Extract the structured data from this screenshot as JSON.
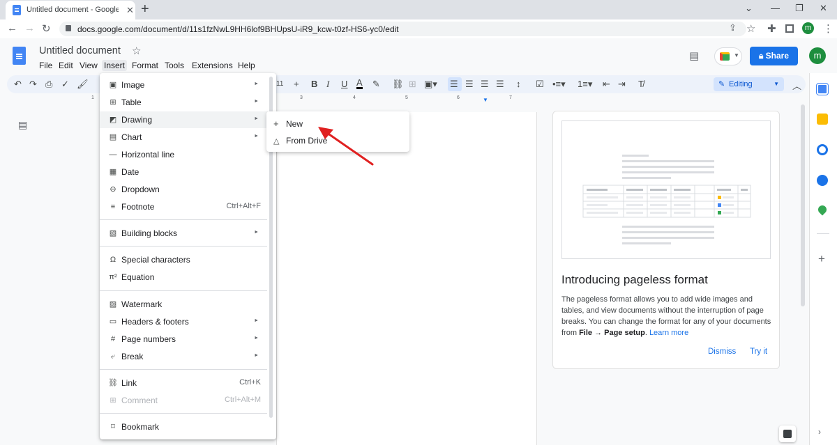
{
  "browser": {
    "tab_title": "Untitled document - Google Doc",
    "url": "docs.google.com/document/d/11s1fzNwL9HH6lof9BHUpsU-iR9_kcw-t0zf-HS6-yc0/edit",
    "profile_initial": "m"
  },
  "docs": {
    "title": "Untitled document",
    "menus": [
      "File",
      "Edit",
      "View",
      "Insert",
      "Format",
      "Tools",
      "Extensions",
      "Help"
    ],
    "share_label": "Share",
    "avatar_initial": "m",
    "editing_mode": "Editing",
    "font_size": "11",
    "ruler_marks": [
      "1",
      "3",
      "4",
      "5",
      "6",
      "7"
    ]
  },
  "insert_menu": {
    "items": [
      {
        "label": "Image",
        "icon": "image-icon",
        "submenu": true
      },
      {
        "label": "Table",
        "icon": "table-icon",
        "submenu": true
      },
      {
        "label": "Drawing",
        "icon": "drawing-icon",
        "submenu": true,
        "highlighted": true
      },
      {
        "label": "Chart",
        "icon": "chart-icon",
        "submenu": true
      },
      {
        "label": "Horizontal line",
        "icon": "horizontal-line-icon"
      },
      {
        "label": "Date",
        "icon": "calendar-icon"
      },
      {
        "label": "Dropdown",
        "icon": "dropdown-icon"
      },
      {
        "label": "Footnote",
        "icon": "footnote-icon",
        "shortcut": "Ctrl+Alt+F"
      },
      {
        "label": "Building blocks",
        "icon": "building-blocks-icon",
        "submenu": true
      },
      {
        "label": "Special characters",
        "icon": "omega-icon"
      },
      {
        "label": "Equation",
        "icon": "pi-icon"
      },
      {
        "label": "Watermark",
        "icon": "watermark-icon"
      },
      {
        "label": "Headers & footers",
        "icon": "header-footer-icon",
        "submenu": true
      },
      {
        "label": "Page numbers",
        "icon": "hash-icon",
        "submenu": true
      },
      {
        "label": "Break",
        "icon": "break-icon",
        "submenu": true
      },
      {
        "label": "Link",
        "icon": "link-icon",
        "shortcut": "Ctrl+K"
      },
      {
        "label": "Comment",
        "icon": "comment-add-icon",
        "shortcut": "Ctrl+Alt+M",
        "disabled": true
      },
      {
        "label": "Bookmark",
        "icon": "bookmark-icon"
      }
    ]
  },
  "drawing_submenu": {
    "items": [
      {
        "label": "New",
        "icon": "plus-icon"
      },
      {
        "label": "From Drive",
        "icon": "drive-icon"
      }
    ]
  },
  "pageless_card": {
    "title": "Introducing pageless format",
    "body_1": "The pageless format allows you to add wide images and tables, and view documents without the interruption of page breaks. You can change the format for any of your documents from ",
    "body_bold": "File → Page setup",
    "body_2": ". ",
    "learn_more": "Learn more",
    "dismiss_label": "Dismiss",
    "try_label": "Try it"
  },
  "colors": {
    "accent": "#1a73e8",
    "annotation_arrow": "#e02020"
  }
}
